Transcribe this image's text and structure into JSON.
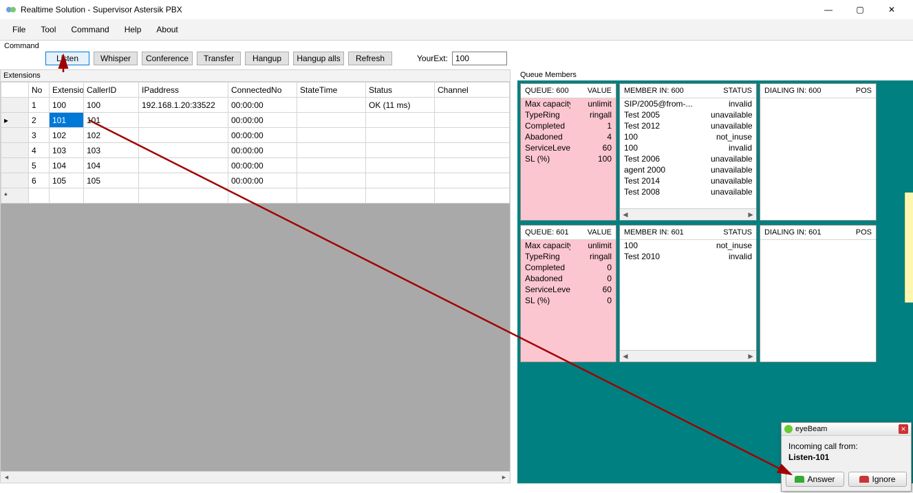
{
  "window": {
    "title": "Realtime Solution - Supervisor Astersik PBX"
  },
  "menu": {
    "file": "File",
    "tool": "Tool",
    "command": "Command",
    "help": "Help",
    "about": "About"
  },
  "command": {
    "label": "Command",
    "listen": "Listen",
    "whisper": "Whisper",
    "conference": "Conference",
    "transfer": "Transfer",
    "hangup": "Hangup",
    "hangupalls": "Hangup alls",
    "refresh": "Refresh",
    "yourext_label": "YourExt:",
    "yourext_value": "100"
  },
  "extensions": {
    "label": "Extensions",
    "headers": {
      "no": "No",
      "ext": "Extension",
      "cid": "CallerID",
      "ip": "IPaddress",
      "conn": "ConnectedNo",
      "state": "StateTime",
      "status": "Status",
      "channel": "Channel"
    },
    "rows": [
      {
        "no": "1",
        "ext": "100",
        "cid": "100",
        "ip": "192.168.1.20:33522",
        "conn": "00:00:00",
        "state": "",
        "status": "OK (11 ms)",
        "channel": ""
      },
      {
        "no": "2",
        "ext": "101",
        "cid": "101",
        "ip": "",
        "conn": "00:00:00",
        "state": "",
        "status": "",
        "channel": ""
      },
      {
        "no": "3",
        "ext": "102",
        "cid": "102",
        "ip": "",
        "conn": "00:00:00",
        "state": "",
        "status": "",
        "channel": ""
      },
      {
        "no": "4",
        "ext": "103",
        "cid": "103",
        "ip": "",
        "conn": "00:00:00",
        "state": "",
        "status": "",
        "channel": ""
      },
      {
        "no": "5",
        "ext": "104",
        "cid": "104",
        "ip": "",
        "conn": "00:00:00",
        "state": "",
        "status": "",
        "channel": ""
      },
      {
        "no": "6",
        "ext": "105",
        "cid": "105",
        "ip": "",
        "conn": "00:00:00",
        "state": "",
        "status": "",
        "channel": ""
      }
    ]
  },
  "queues": {
    "label": "Queue Members",
    "cards": [
      {
        "queue_hdr": "QUEUE: 600",
        "value_hdr": "VALUE",
        "queue_rows": [
          {
            "k": "Max capacity",
            "v": "unlimit"
          },
          {
            "k": "TypeRing",
            "v": "ringall"
          },
          {
            "k": "Completed",
            "v": "1"
          },
          {
            "k": "Abadoned",
            "v": "4"
          },
          {
            "k": "ServiceLevel...",
            "v": "60"
          },
          {
            "k": "SL (%)",
            "v": "100"
          }
        ],
        "member_hdr": "MEMBER IN: 600",
        "status_hdr": "STATUS",
        "member_rows": [
          {
            "k": "SIP/2005@from-...",
            "v": "invalid"
          },
          {
            "k": "Test 2005",
            "v": "unavailable"
          },
          {
            "k": "Test 2012",
            "v": "unavailable"
          },
          {
            "k": "100",
            "v": "not_inuse"
          },
          {
            "k": "100",
            "v": "invalid"
          },
          {
            "k": "Test 2006",
            "v": "unavailable"
          },
          {
            "k": "agent 2000",
            "v": "unavailable"
          },
          {
            "k": "Test 2014",
            "v": "unavailable"
          },
          {
            "k": "Test 2008",
            "v": "unavailable"
          }
        ],
        "dialing_hdr": "DIALING IN: 600",
        "pos_hdr": "POS",
        "dialing_rows": []
      },
      {
        "queue_hdr": "QUEUE: 601",
        "value_hdr": "VALUE",
        "queue_rows": [
          {
            "k": "Max capacity",
            "v": "unlimit"
          },
          {
            "k": "TypeRing",
            "v": "ringall"
          },
          {
            "k": "Completed",
            "v": "0"
          },
          {
            "k": "Abadoned",
            "v": "0"
          },
          {
            "k": "ServiceLevel...",
            "v": "60"
          },
          {
            "k": "SL (%)",
            "v": "0"
          }
        ],
        "member_hdr": "MEMBER IN: 601",
        "status_hdr": "STATUS",
        "member_rows": [
          {
            "k": "100",
            "v": "not_inuse"
          },
          {
            "k": "Test 2010",
            "v": "invalid"
          }
        ],
        "dialing_hdr": "DIALING IN: 601",
        "pos_hdr": "POS",
        "dialing_rows": []
      }
    ]
  },
  "popup": {
    "title": "eyeBeam",
    "msg": "Incoming call from:",
    "from": "Listen-101",
    "answer": "Answer",
    "ignore": "Ignore"
  }
}
